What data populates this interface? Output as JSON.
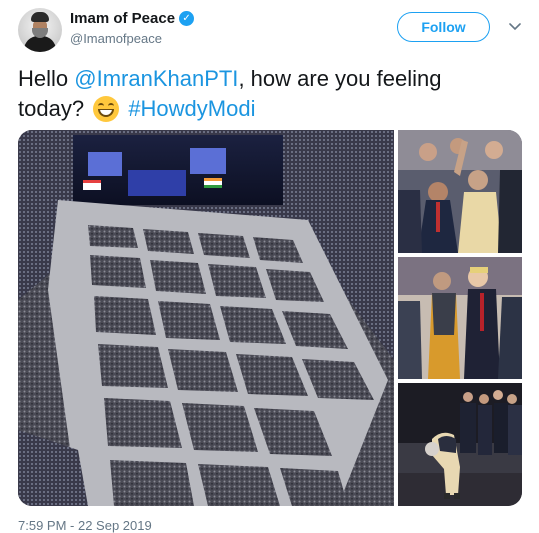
{
  "author": {
    "name": "Imam of Peace",
    "handle": "@Imamofpeace",
    "verified_icon": "verified-badge-icon"
  },
  "actions": {
    "follow_label": "Follow",
    "more_icon": "chevron-down-icon"
  },
  "tweet": {
    "text_start": "Hello ",
    "mention": "@ImranKhanPTI",
    "text_middle": ", how are you feeling today?",
    "emoji": "grinning-face-emoji",
    "hashtag": "#HowdyModi"
  },
  "media": {
    "count": 4,
    "items": [
      "stadium-crowd-photo",
      "leaders-wave-photo",
      "leaders-walk-photo",
      "leader-bow-photo"
    ]
  },
  "timestamp": "7:59 PM - 22 Sep 2019",
  "colors": {
    "link": "#1b95e0",
    "follow": "#1da1f2",
    "secondary_text": "#657786"
  }
}
